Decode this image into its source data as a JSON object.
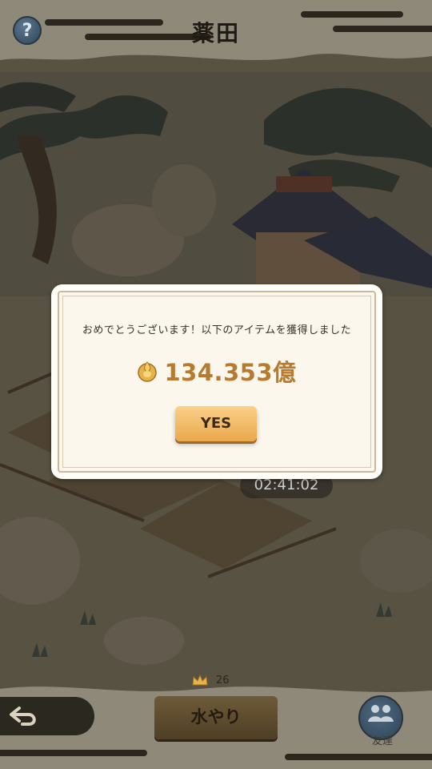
{
  "header": {
    "title": "薬田",
    "help_label": "?"
  },
  "farm": {
    "timer": "02:41:02"
  },
  "dialog": {
    "message": "おめでとうございます！以下のアイテムを獲得しました",
    "reward_amount": "134.353億",
    "reward_icon": "gold-coin-icon",
    "confirm_label": "YES"
  },
  "bottom_bar": {
    "crown_count": "26",
    "water_label": "水やり",
    "friends_label": "友達"
  },
  "colors": {
    "accent": "#e9a84c",
    "reward_text": "#b87a2f",
    "dialog_bg": "#fbf7ec"
  }
}
